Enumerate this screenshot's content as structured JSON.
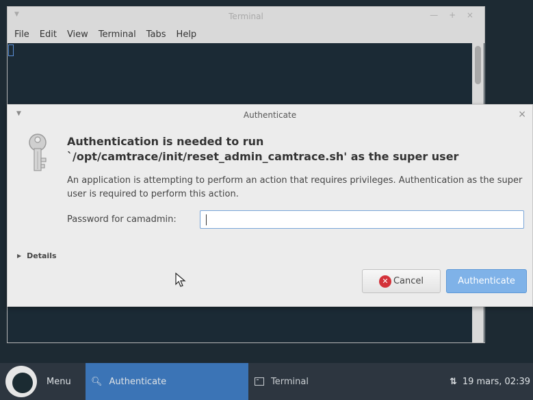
{
  "terminal": {
    "title": "Terminal",
    "menu": [
      "File",
      "Edit",
      "View",
      "Terminal",
      "Tabs",
      "Help"
    ],
    "controls": "— + ×"
  },
  "dialog": {
    "title": "Authenticate",
    "heading": "Authentication is needed to run `/opt/camtrace/init/reset_admin_camtrace.sh' as the super user",
    "description": "An application is attempting to perform an action that requires privileges. Authentication as the super user is required to perform this action.",
    "password_label": "Password for camadmin:",
    "password_value": "",
    "details_label": "Details",
    "cancel_label": "Cancel",
    "authenticate_label": "Authenticate"
  },
  "taskbar": {
    "menu_label": "Menu",
    "tasks": [
      "Authenticate",
      "Terminal"
    ],
    "clock": "19 mars, 02:39"
  },
  "colors": {
    "accent": "#3b74b6",
    "primary_button": "#7fb2e8",
    "cancel_icon": "#d3323a",
    "terminal_bg": "#1b2a35"
  },
  "icons": [
    "key-icon",
    "cancel-icon",
    "search-icon",
    "terminal-icon",
    "network-icon",
    "chevron-down-icon",
    "close-icon"
  ]
}
